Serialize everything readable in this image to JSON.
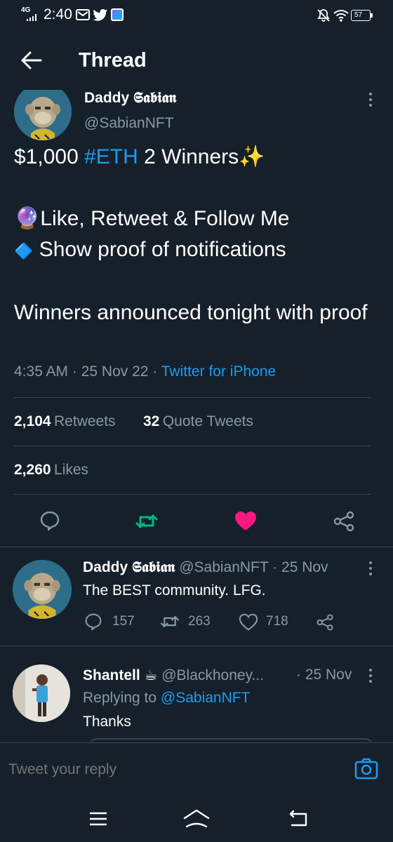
{
  "status_bar": {
    "network": "4G",
    "time": "2:40",
    "battery": "57",
    "icons_left": [
      "mail-icon",
      "twitter-bird-icon",
      "app-icon"
    ],
    "icons_right": [
      "bell-off-icon",
      "wifi-icon",
      "battery-icon"
    ]
  },
  "header": {
    "title": "Thread"
  },
  "main_tweet": {
    "display_name": "Daddy 𝕾𝖆𝖇𝖎𝖆𝖓",
    "handle": "@SabianNFT",
    "line1_a": "$1,000 ",
    "line1_hashtag": "#ETH",
    "line1_b": " 2 Winners",
    "line1_emoji": "✨",
    "line2_emoji": "🔮",
    "line2": "Like, Retweet & Follow Me",
    "line3_emoji": "🔷",
    "line3": "Show proof of notifications",
    "line4": "Winners announced tonight with proof",
    "time": "4:35 AM",
    "date": "25 Nov 22",
    "source": "Twitter for iPhone",
    "retweets_count": "2,104",
    "retweets_label": "Retweets",
    "quotes_count": "32",
    "quotes_label": "Quote Tweets",
    "likes_count": "2,260",
    "likes_label": "Likes"
  },
  "replies": [
    {
      "display_name": "Daddy 𝕾𝖆𝖇𝖎𝖆𝖓",
      "handle": "@SabianNFT",
      "date": "25 Nov",
      "text": "The BEST community. LFG.",
      "reply_count": "157",
      "retweet_count": "263",
      "like_count": "718"
    },
    {
      "display_name": "Shantell",
      "name_emoji": "☕",
      "handle": "@Blackhoney...",
      "date": "25 Nov",
      "replying_prefix": "Replying to",
      "replying_to": "@SabianNFT",
      "text": "Thanks"
    }
  ],
  "reply_box": {
    "placeholder": "Tweet your reply"
  },
  "colors": {
    "background": "#15202b",
    "accent": "#1d9bf0",
    "like": "#f91880",
    "retweet": "#00ba7c",
    "muted": "#8899a6"
  }
}
